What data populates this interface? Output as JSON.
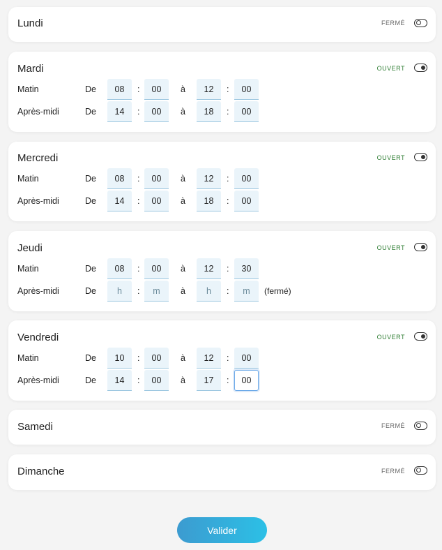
{
  "days": {
    "lundi": {
      "name": "Lundi",
      "status": "FERMÉ",
      "open": false
    },
    "mardi": {
      "name": "Mardi",
      "status": "OUVERT",
      "open": true,
      "matin": {
        "label": "Matin",
        "de": "De",
        "a": "à",
        "from_h": "08",
        "from_m": "00",
        "to_h": "12",
        "to_m": "00"
      },
      "apres": {
        "label": "Après-midi",
        "de": "De",
        "a": "à",
        "from_h": "14",
        "from_m": "00",
        "to_h": "18",
        "to_m": "00"
      }
    },
    "mercredi": {
      "name": "Mercredi",
      "status": "OUVERT",
      "open": true,
      "matin": {
        "label": "Matin",
        "de": "De",
        "a": "à",
        "from_h": "08",
        "from_m": "00",
        "to_h": "12",
        "to_m": "00"
      },
      "apres": {
        "label": "Après-midi",
        "de": "De",
        "a": "à",
        "from_h": "14",
        "from_m": "00",
        "to_h": "18",
        "to_m": "00"
      }
    },
    "jeudi": {
      "name": "Jeudi",
      "status": "OUVERT",
      "open": true,
      "matin": {
        "label": "Matin",
        "de": "De",
        "a": "à",
        "from_h": "08",
        "from_m": "00",
        "to_h": "12",
        "to_m": "30"
      },
      "apres": {
        "label": "Après-midi",
        "de": "De",
        "a": "à",
        "placeholder_h": "h",
        "placeholder_m": "m",
        "note": "(fermé)"
      }
    },
    "vendredi": {
      "name": "Vendredi",
      "status": "OUVERT",
      "open": true,
      "matin": {
        "label": "Matin",
        "de": "De",
        "a": "à",
        "from_h": "10",
        "from_m": "00",
        "to_h": "12",
        "to_m": "00"
      },
      "apres": {
        "label": "Après-midi",
        "de": "De",
        "a": "à",
        "from_h": "14",
        "from_m": "00",
        "to_h": "17",
        "to_m": "00"
      }
    },
    "samedi": {
      "name": "Samedi",
      "status": "FERMÉ",
      "open": false
    },
    "dimanche": {
      "name": "Dimanche",
      "status": "FERMÉ",
      "open": false
    }
  },
  "separator": ":",
  "submit_label": "Valider",
  "colors": {
    "open_status": "#2e7d32",
    "closed_status": "#666666",
    "button_start": "#3c9bd0",
    "button_end": "#2cc0e6",
    "input_bg": "#eaf4fa"
  }
}
